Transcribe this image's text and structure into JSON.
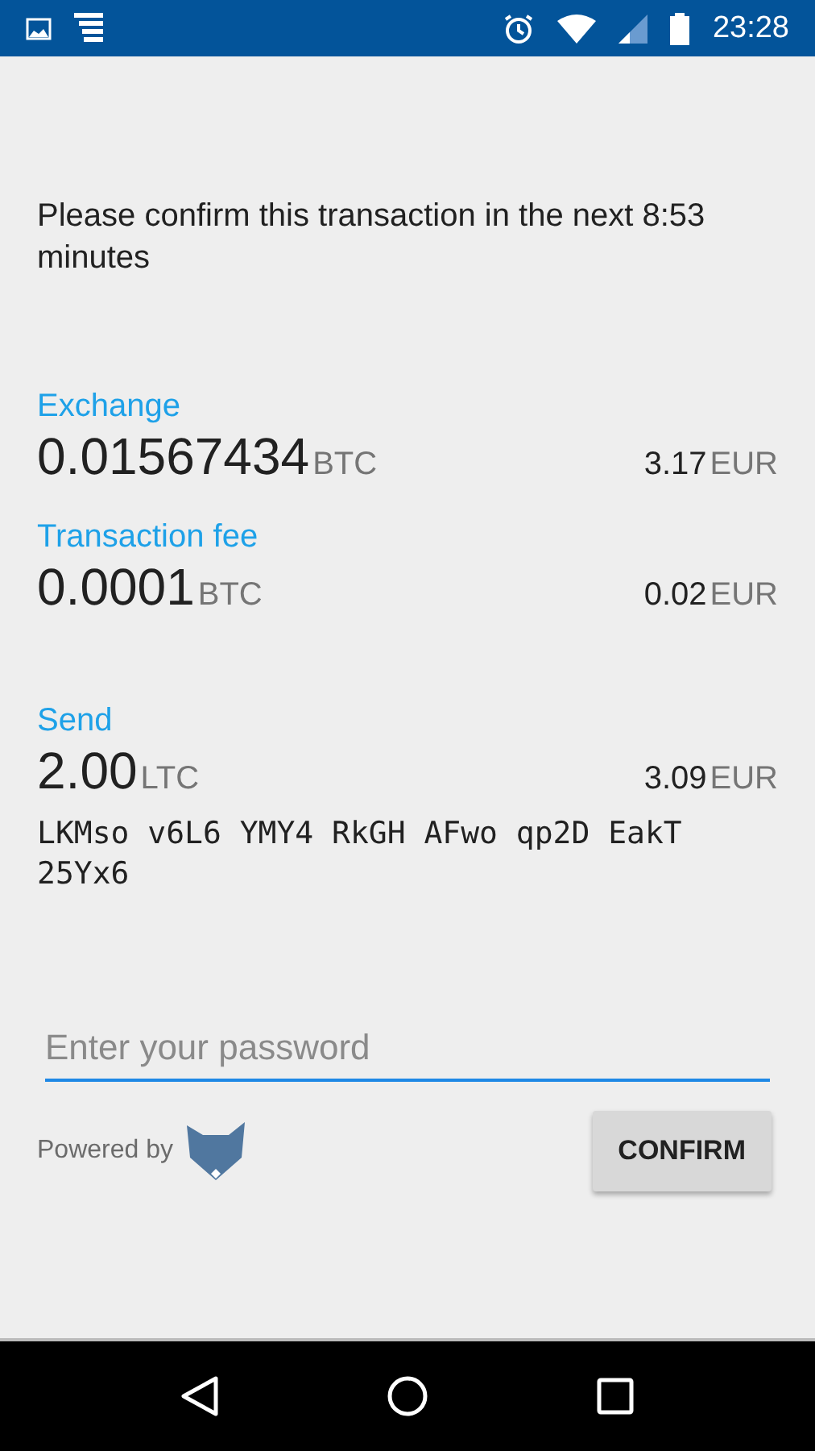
{
  "status_bar": {
    "time": "23:28"
  },
  "message": "Please confirm this transaction in the next 8:53 minutes",
  "entries": [
    {
      "label": "Exchange",
      "amount": "0.01567434",
      "unit": "BTC",
      "fiat": "3.17",
      "fiat_unit": "EUR"
    },
    {
      "label": "Transaction fee",
      "amount": "0.0001",
      "unit": "BTC",
      "fiat": "0.02",
      "fiat_unit": "EUR"
    },
    {
      "label": "Send",
      "amount": "2.00",
      "unit": "LTC",
      "fiat": "3.09",
      "fiat_unit": "EUR",
      "address": "LKMso v6L6 YMY4 RkGH AFwo qp2D EakT 25Yx6"
    }
  ],
  "password": {
    "placeholder": "Enter your password"
  },
  "powered_by": "Powered by",
  "confirm_button": "CONFIRM"
}
